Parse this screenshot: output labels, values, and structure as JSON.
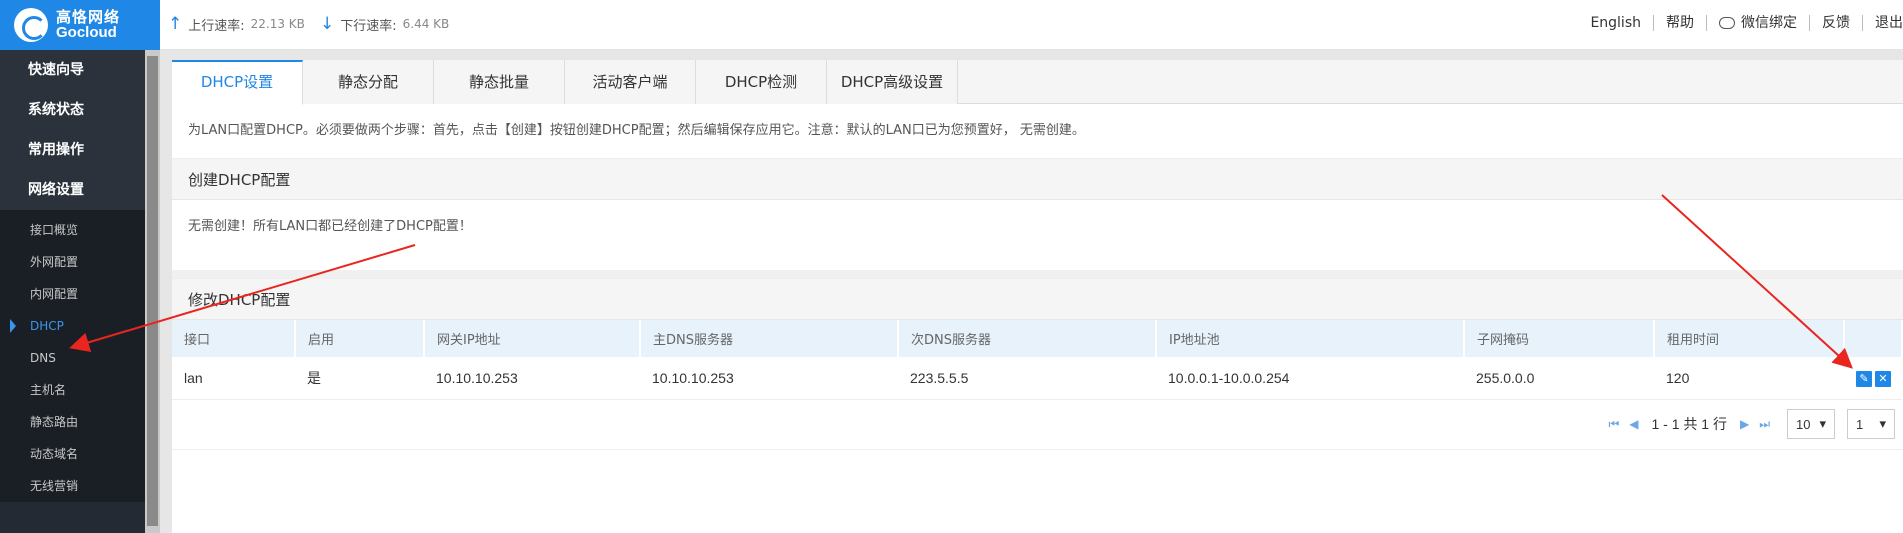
{
  "header": {
    "logo_cn": "高恪网络",
    "logo_en": "Gocloud",
    "upload_label": "上行速率:",
    "upload_value": "22.13 KB",
    "download_label": "下行速率:",
    "download_value": "6.44 KB",
    "links": [
      "English",
      "帮助",
      "微信绑定",
      "反馈",
      "退出"
    ]
  },
  "sidebar": {
    "main_items": [
      "快速向导",
      "系统状态",
      "常用操作",
      "网络设置"
    ],
    "sub_items": [
      "接口概览",
      "外网配置",
      "内网配置",
      "DHCP",
      "DNS",
      "主机名",
      "静态路由",
      "动态域名",
      "无线营销"
    ],
    "active_sub": "DHCP"
  },
  "tabs": [
    "DHCP设置",
    "静态分配",
    "静态批量",
    "活动客户端",
    "DHCP检测",
    "DHCP高级设置"
  ],
  "active_tab": "DHCP设置",
  "notice": "为LAN口配置DHCP。必须要做两个步骤：首先，点击【创建】按钮创建DHCP配置；然后编辑保存应用它。注意：默认的LAN口已为您预置好， 无需创建。",
  "create_section": {
    "title": "创建DHCP配置",
    "message": "无需创建！所有LAN口都已经创建了DHCP配置！"
  },
  "edit_section": {
    "title": "修改DHCP配置",
    "columns": [
      "接口",
      "启用",
      "网关IP地址",
      "主DNS服务器",
      "次DNS服务器",
      "IP地址池",
      "子网掩码",
      "租用时间"
    ],
    "rows": [
      [
        "lan",
        "是",
        "10.10.10.253",
        "10.10.10.253",
        "223.5.5.5",
        "10.0.0.1-10.0.0.254",
        "255.0.0.0",
        "120"
      ]
    ]
  },
  "pager": {
    "summary": "1 - 1 共 1 行",
    "page_size": "10",
    "page": "1"
  },
  "colors": {
    "accent": "#1f87e5",
    "sidebar_bg": "#232a33",
    "annotation_arrow": "#e8251f"
  }
}
